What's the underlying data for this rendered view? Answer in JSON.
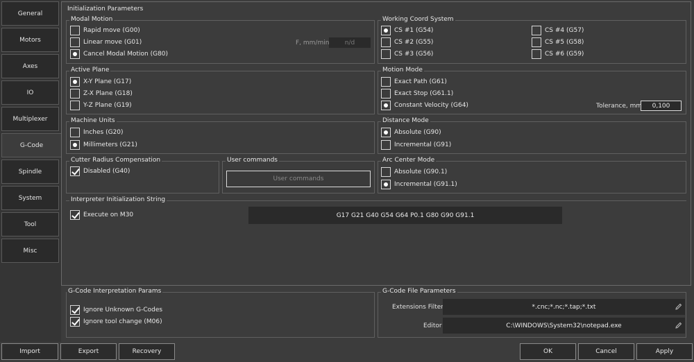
{
  "tabs": [
    "General",
    "Motors",
    "Axes",
    "IO",
    "Multiplexer",
    "G-Code",
    "Spindle",
    "System",
    "Tool",
    "Misc"
  ],
  "main_title": "Initialization Parameters",
  "modal_motion": {
    "title": "Modal Motion",
    "rapid": "Rapid move (G00)",
    "linear": "Linear move (G01)",
    "cancel": "Cancel Modal Motion (G80)",
    "feed_label": "F, mm/min",
    "feed_value": "n/d"
  },
  "wcs": {
    "title": "Working Coord System",
    "cs1": "CS #1 (G54)",
    "cs2": "CS #2 (G55)",
    "cs3": "CS #3 (G56)",
    "cs4": "CS #4 (G57)",
    "cs5": "CS #5 (G58)",
    "cs6": "CS #6 (G59)"
  },
  "active_plane": {
    "title": "Active Plane",
    "xy": "X-Y Plane (G17)",
    "zx": "Z-X Plane (G18)",
    "yz": "Y-Z Plane (G19)"
  },
  "motion_mode": {
    "title": "Motion Mode",
    "exact_path": "Exact Path (G61)",
    "exact_stop": "Exact Stop (G61.1)",
    "const_vel": "Constant Velocity (G64)",
    "tol_label": "Tolerance, mm",
    "tol_value": "0,100"
  },
  "machine_units": {
    "title": "Machine Units",
    "inches": "Inches (G20)",
    "mm": "Millimeters (G21)"
  },
  "distance_mode": {
    "title": "Distance Mode",
    "absolute": "Absolute (G90)",
    "incremental": "Incremental (G91)"
  },
  "cutter": {
    "title": "Cutter Radius Compensation",
    "disabled": "Disabled (G40)"
  },
  "user_commands": {
    "title": "User commands",
    "button": "User commands"
  },
  "arc_center": {
    "title": "Arc Center Mode",
    "absolute": "Absolute (G90.1)",
    "incremental": "Incremental (G91.1)"
  },
  "init_string": {
    "title": "Interpreter Initialization String",
    "execute": "Execute on M30",
    "value": "G17 G21 G40 G54 G64 P0.1 G80 G90 G91.1"
  },
  "interp_params": {
    "title": "G-Code Interpretation Params",
    "ignore_unknown": "Ignore Unknown G-Codes",
    "ignore_tool": "Ignore tool change (M06)"
  },
  "file_params": {
    "title": "G-Code File Parameters",
    "ext_label": "Extensions Filter",
    "ext_value": "*.cnc;*.nc;*.tap;*.txt",
    "editor_label": "Editor",
    "editor_value": "C:\\WINDOWS\\System32\\notepad.exe"
  },
  "buttons": {
    "import": "Import",
    "export": "Export",
    "recovery": "Recovery",
    "ok": "OK",
    "cancel": "Cancel",
    "apply": "Apply"
  }
}
